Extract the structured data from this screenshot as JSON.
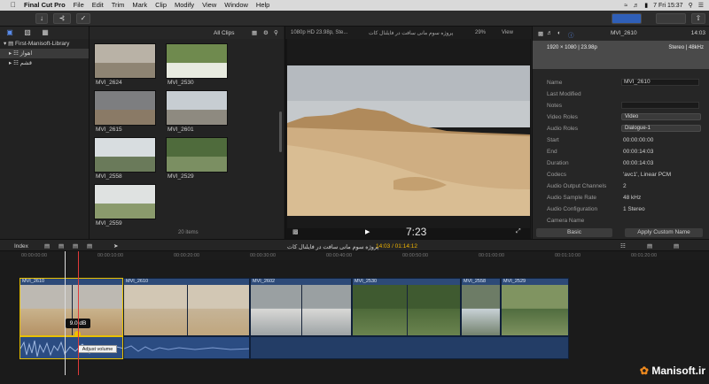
{
  "menubar": {
    "app": "Final Cut Pro",
    "items": [
      "File",
      "Edit",
      "Trim",
      "Mark",
      "Clip",
      "Modify",
      "View",
      "Window",
      "Help"
    ],
    "clock": "7 Fri 15:37"
  },
  "libraries": {
    "root": "First-Manisoft-Library",
    "events": [
      "اهواز",
      "قشم"
    ]
  },
  "browser": {
    "filter": "All Clips",
    "items_count": "20 items",
    "clips": [
      {
        "name": "MVI_2624",
        "colors": [
          "#b9b2a6",
          "#8e8473"
        ]
      },
      {
        "name": "MVI_2530",
        "colors": [
          "#6f8a4e",
          "#e8ebe0"
        ]
      },
      {
        "name": "MVI_2615",
        "colors": [
          "#7d7e80",
          "#8a7a66"
        ]
      },
      {
        "name": "MVI_2601",
        "colors": [
          "#c7cdd2",
          "#8e8a80"
        ]
      },
      {
        "name": "MVI_2558",
        "colors": [
          "#d8dde0",
          "#6a7a5a"
        ]
      },
      {
        "name": "MVI_2529",
        "colors": [
          "#4f6b3c",
          "#7b8f62"
        ]
      },
      {
        "name": "MVI_2559",
        "colors": [
          "#dfe2e1",
          "#8a9a6c"
        ]
      }
    ]
  },
  "viewer": {
    "format": "1080p HD 23.98p, Ste...",
    "project_title": "پروژه سوم مانی سافت در فایلنال کات",
    "zoom": "29%",
    "view_label": "View",
    "timecode": "7:23"
  },
  "inspector": {
    "clip_name": "MVI_2610",
    "duration_top": "14:03",
    "res": "1920 × 1080 | 23.98p",
    "audio_fmt": "Stereo | 48kHz",
    "rows": [
      {
        "label": "Name",
        "value": "MVI_2610",
        "kind": "field"
      },
      {
        "label": "Last Modified",
        "value": "",
        "kind": "none"
      },
      {
        "label": "Notes",
        "value": "",
        "kind": "field"
      },
      {
        "label": "Video Roles",
        "value": "Video",
        "kind": "drop"
      },
      {
        "label": "Audio Roles",
        "value": "Dialogue-1",
        "kind": "drop"
      },
      {
        "label": "Start",
        "value": "00:00:00:00",
        "kind": "text"
      },
      {
        "label": "End",
        "value": "00:00:14:03",
        "kind": "text"
      },
      {
        "label": "Duration",
        "value": "00:00:14:03",
        "kind": "text"
      },
      {
        "label": "Codecs",
        "value": "'avc1', Linear PCM",
        "kind": "text"
      },
      {
        "label": "Audio Output Channels",
        "value": "2",
        "kind": "text"
      },
      {
        "label": "Audio Sample Rate",
        "value": "48 kHz",
        "kind": "text"
      },
      {
        "label": "Audio Configuration",
        "value": "1 Stereo",
        "kind": "text"
      },
      {
        "label": "Camera Name",
        "value": "",
        "kind": "none"
      }
    ],
    "basic_label": "Basic",
    "apply_label": "Apply Custom Name"
  },
  "timeline": {
    "index_label": "Index",
    "project_title": "پروژه سوم مانی سافت در فایلنال کات",
    "timecode": "14:03 / 01:14:12",
    "ruler": [
      "00:00:00:00",
      "00:00:10:00",
      "00:00:20:00",
      "00:00:30:00",
      "00:00:40:00",
      "00:00:50:00",
      "00:01:00:00",
      "00:01:10:00",
      "00:01:20:00"
    ],
    "clips": [
      {
        "name": "MVI_2610",
        "colors": [
          "#c9b38c",
          "#b38f62",
          "#bdb9b2"
        ]
      },
      {
        "name": "MVI_2610",
        "colors": [
          "#c6b497",
          "#bfa57c",
          "#d2c7b4"
        ]
      },
      {
        "name": "MVI_2602",
        "colors": [
          "#d8d8d6",
          "#9aa0a2"
        ]
      },
      {
        "name": "MVI_2530",
        "colors": [
          "#4e6a3a",
          "#6c8550",
          "#3f5a30"
        ]
      },
      {
        "name": "MVI_2558",
        "colors": [
          "#c8d1d6",
          "#6d7c66"
        ]
      },
      {
        "name": "MVI_2529",
        "colors": [
          "#516d3f",
          "#809461"
        ]
      }
    ],
    "volume_label": "9.0 dB",
    "tooltip": "Adjust volume"
  },
  "watermark": "Manisoft.ir"
}
